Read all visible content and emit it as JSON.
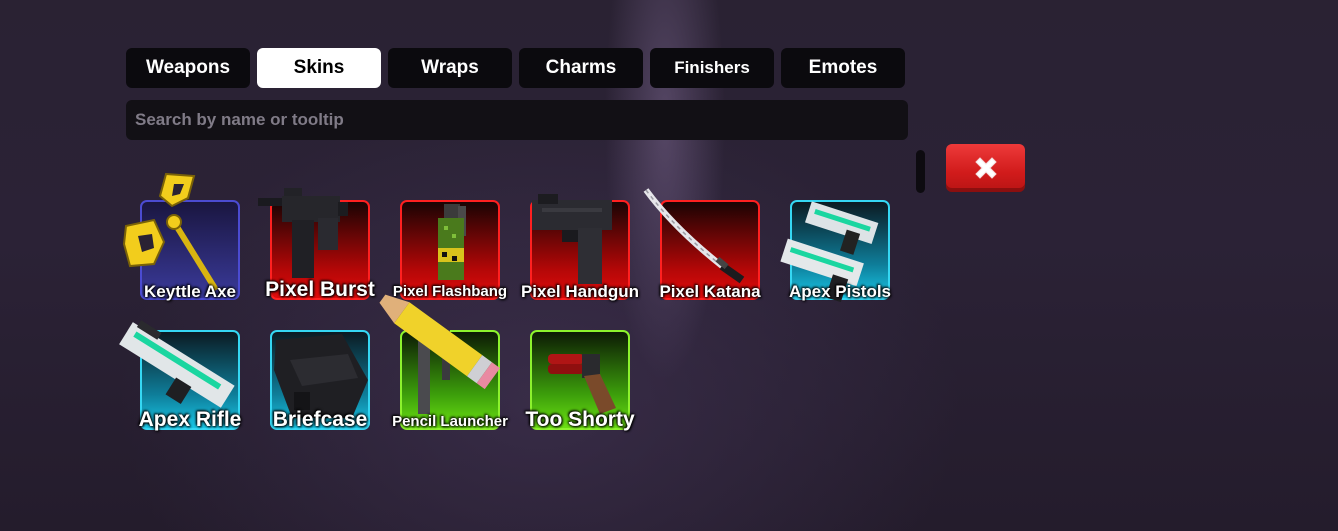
{
  "tabs": [
    {
      "label": "Weapons",
      "active": false
    },
    {
      "label": "Skins",
      "active": true
    },
    {
      "label": "Wraps",
      "active": false
    },
    {
      "label": "Charms",
      "active": false
    },
    {
      "label": "Finishers",
      "active": false
    },
    {
      "label": "Emotes",
      "active": false
    }
  ],
  "search": {
    "placeholder": "Search by name or tooltip",
    "value": ""
  },
  "close_button": {
    "icon": "close-icon"
  },
  "skins": [
    {
      "name": "Keyttle Axe",
      "rarity_color": "#4b4bd1"
    },
    {
      "name": "Pixel Burst",
      "rarity_color": "#ff2020"
    },
    {
      "name": "Pixel Flashbang",
      "rarity_color": "#ff2020"
    },
    {
      "name": "Pixel Handgun",
      "rarity_color": "#ff2020"
    },
    {
      "name": "Pixel Katana",
      "rarity_color": "#ff2020"
    },
    {
      "name": "Apex Pistols",
      "rarity_color": "#35d7f3"
    },
    {
      "name": "Apex Rifle",
      "rarity_color": "#35d7f3"
    },
    {
      "name": "Briefcase",
      "rarity_color": "#35d7f3"
    },
    {
      "name": "Pencil Launcher",
      "rarity_color": "#8cf22d"
    },
    {
      "name": "Too Shorty",
      "rarity_color": "#8cf22d"
    }
  ]
}
